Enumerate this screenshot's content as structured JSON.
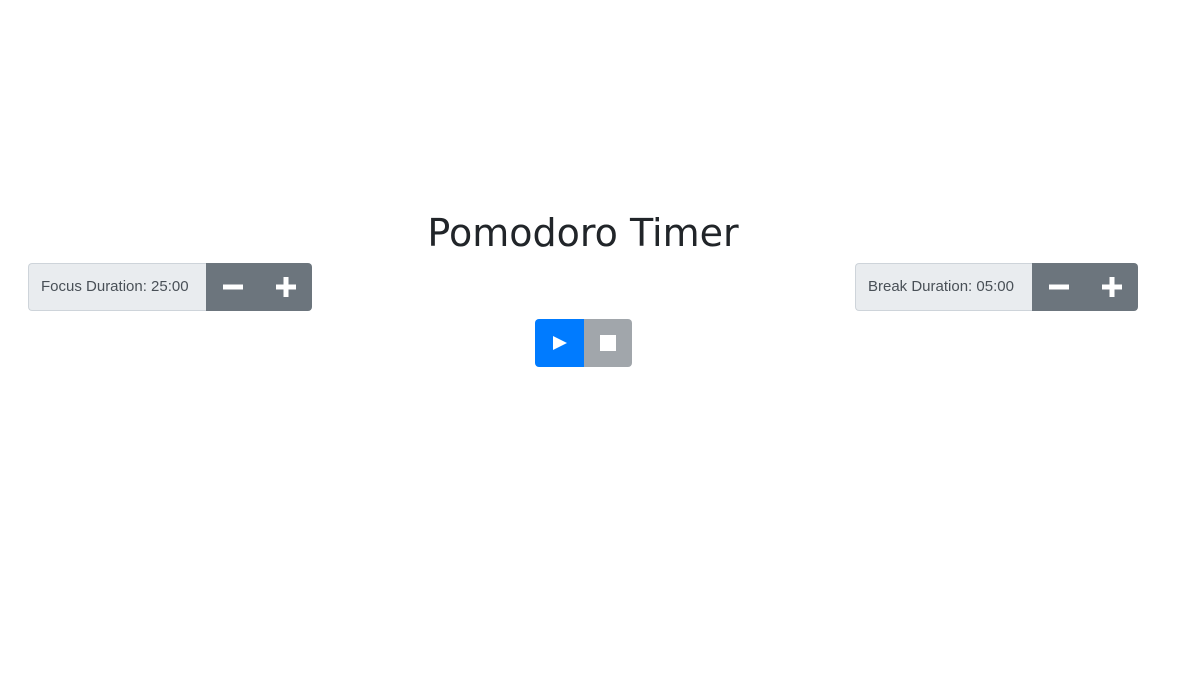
{
  "page": {
    "title": "Pomodoro Timer"
  },
  "focus": {
    "label": "Focus Duration: 25:00",
    "decrease_icon": "minus-icon",
    "increase_icon": "plus-icon"
  },
  "break": {
    "label": "Break Duration: 05:00",
    "decrease_icon": "minus-icon",
    "increase_icon": "plus-icon"
  },
  "controls": {
    "start_icon": "play-icon",
    "stop_icon": "stop-icon"
  },
  "colors": {
    "primary": "#007bff",
    "secondary": "#6c757d",
    "disabled": "#a1a6ab",
    "label_background": "#e9ecef",
    "text": "#212529"
  }
}
